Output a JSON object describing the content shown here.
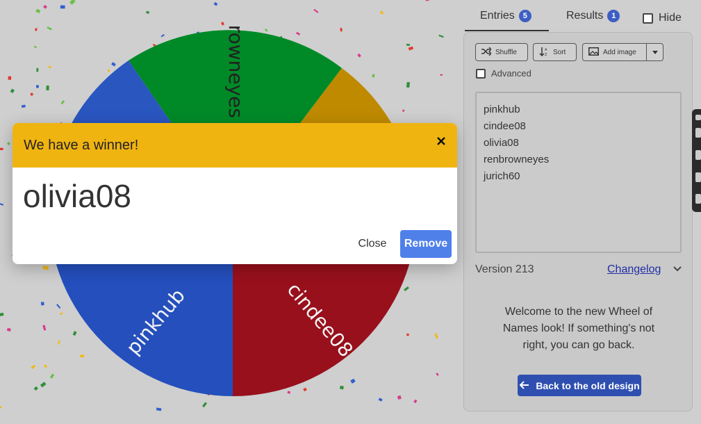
{
  "wheel": {
    "segments": [
      {
        "label": "renbrowneyes",
        "visible_label": "rowneyes",
        "color": "#008a27"
      },
      {
        "label": "jurich60",
        "color": "#bf8a00"
      },
      {
        "label": "cindee08",
        "color": "#98101c"
      },
      {
        "label": "pinkhub",
        "color": "#244fbd"
      },
      {
        "label": "olivia08",
        "color": "#2a56c0"
      }
    ]
  },
  "tabs": {
    "entries": {
      "label": "Entries",
      "count": "5"
    },
    "results": {
      "label": "Results",
      "count": "1"
    },
    "hide_label": "Hide"
  },
  "toolbar": {
    "shuffle_label": "Shuffle",
    "sort_label": "Sort",
    "add_image_label": "Add image",
    "advanced_label": "Advanced"
  },
  "entries": [
    "pinkhub",
    "cindee08",
    "olivia08",
    "renbrowneyes",
    "jurich60"
  ],
  "version": {
    "text": "Version 213",
    "changelog_label": "Changelog"
  },
  "welcome": {
    "message": "Welcome to the new Wheel of Names look! If something's not right, you can go back.",
    "button_label": "Back to the old design"
  },
  "modal": {
    "title": "We have a winner!",
    "winner": "olivia08",
    "close_label": "Close",
    "remove_label": "Remove"
  },
  "colors": {
    "header_yellow": "#f0b411",
    "remove_blue": "#4f80ea",
    "badge_blue": "#3d5fc4",
    "old_design_blue": "#2f4fb0"
  },
  "icons": [
    "shuffle-icon",
    "sort-icon",
    "image-icon",
    "chevron-down-icon",
    "close-icon",
    "arrow-left-icon"
  ]
}
